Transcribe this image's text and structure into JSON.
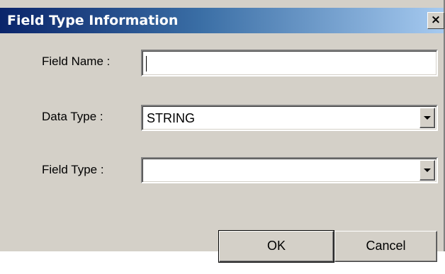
{
  "window": {
    "title": "Field Type Information",
    "close_glyph": "×"
  },
  "form": {
    "field_name": {
      "label": "Field Name :",
      "value": ""
    },
    "data_type": {
      "label": "Data Type  :",
      "value": "STRING"
    },
    "field_type": {
      "label": "Field Type  :",
      "value": ""
    }
  },
  "buttons": {
    "ok_label": "OK",
    "cancel_label": "Cancel"
  },
  "icons": {
    "close": "close-icon",
    "dropdown": "chevron-down-icon"
  },
  "colors": {
    "dialog_bg": "#d4d0c8",
    "title_start": "#0a246a",
    "title_end": "#a6caf0"
  }
}
